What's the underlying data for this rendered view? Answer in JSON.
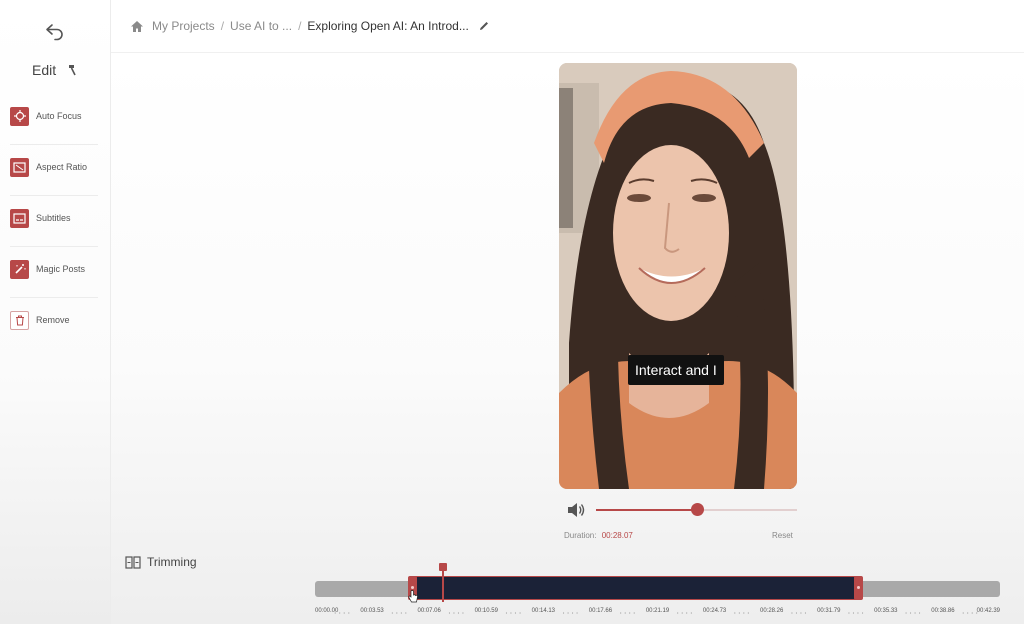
{
  "breadcrumb": {
    "items": [
      "My Projects",
      "Use AI to ...",
      "Exploring Open AI: An Introd..."
    ]
  },
  "sidebar": {
    "edit_label": "Edit",
    "tools": [
      {
        "label": "Auto Focus",
        "icon": "crosshair-icon"
      },
      {
        "label": "Aspect Ratio",
        "icon": "aspect-ratio-icon"
      },
      {
        "label": "Subtitles",
        "icon": "subtitles-icon"
      },
      {
        "label": "Magic Posts",
        "icon": "magic-wand-icon"
      },
      {
        "label": "Remove",
        "icon": "trash-icon"
      }
    ]
  },
  "player": {
    "caption": "Interact and I",
    "volume_level": 0.5,
    "duration_label": "Duration:",
    "duration_value": "00:28.07",
    "reset_label": "Reset"
  },
  "trimming": {
    "label": "Trimming",
    "ticks": [
      "00:00.00",
      "00:03.53",
      "00:07.06",
      "00:10.59",
      "00:14.13",
      "00:17.66",
      "00:21.19",
      "00:24.73",
      "00:28.26",
      "00:31.79",
      "00:35.33",
      "00:38.86",
      "00:42.39"
    ]
  },
  "colors": {
    "accent": "#b74848",
    "selection": "#1b2237",
    "track": "#a9a9a9"
  }
}
